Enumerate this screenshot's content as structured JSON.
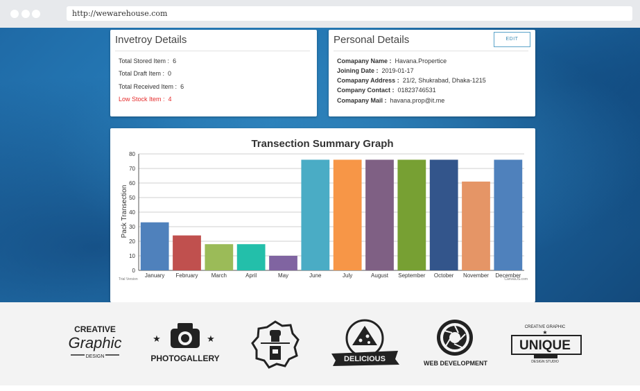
{
  "browser": {
    "url": "http://wewarehouse.com"
  },
  "inventory": {
    "title": "Invetroy Details",
    "rows": [
      {
        "label": "Total Stored Item :",
        "value": "6"
      },
      {
        "label": "Total Draft Item :",
        "value": "0"
      },
      {
        "label": "Total Received Item :",
        "value": "6"
      },
      {
        "label": "Low Stock Item :",
        "value": "4"
      }
    ]
  },
  "personal": {
    "title": "Personal Details",
    "edit_label": "EDIT",
    "rows": [
      {
        "label": "Comapany Name :",
        "value": "Havana.Propertice"
      },
      {
        "label": "Joining Date :",
        "value": "2019-01-17"
      },
      {
        "label": "Comapany Address :",
        "value": "21/2, Shukrabad, Dhaka-1215"
      },
      {
        "label": "Company Contact :",
        "value": "01823746531"
      },
      {
        "label": "Comapany Mail :",
        "value": "havana.prop@it.me"
      }
    ]
  },
  "chart_data": {
    "type": "bar",
    "title": "Transection Summary Graph",
    "ylabel": "Pack Transection",
    "xlabel": "",
    "ylim": [
      0,
      80
    ],
    "yticks": [
      0,
      10,
      20,
      30,
      40,
      50,
      60,
      70,
      80
    ],
    "grid": true,
    "categories": [
      "January",
      "February",
      "March",
      "April",
      "May",
      "June",
      "July",
      "August",
      "September",
      "October",
      "November",
      "December"
    ],
    "values": [
      33,
      24,
      18,
      18,
      10,
      76,
      76,
      76,
      76,
      76,
      61,
      76
    ],
    "colors": [
      "#4f81bc",
      "#c0504e",
      "#9bbb58",
      "#23bfaa",
      "#8064a1",
      "#4aacc5",
      "#f79647",
      "#7f6084",
      "#77a033",
      "#33558b",
      "#e59566",
      "#4f81bc"
    ],
    "watermark_left": "Trial Version",
    "watermark_right": "CanvasJS.com"
  },
  "logos": {
    "creative": {
      "line1": "CREATIVE",
      "line2": "Graphic",
      "line3": "DESIGN"
    },
    "photo": {
      "label": "PHOTOGALLERY"
    },
    "delicious": {
      "label": "DELICIOUS"
    },
    "web": {
      "label": "WEB DEVELOPMENT"
    },
    "unique": {
      "top": "CREATIVE GRAPHIC",
      "label": "UNIQUE",
      "bottom": "DESIGN STUDIO"
    }
  }
}
